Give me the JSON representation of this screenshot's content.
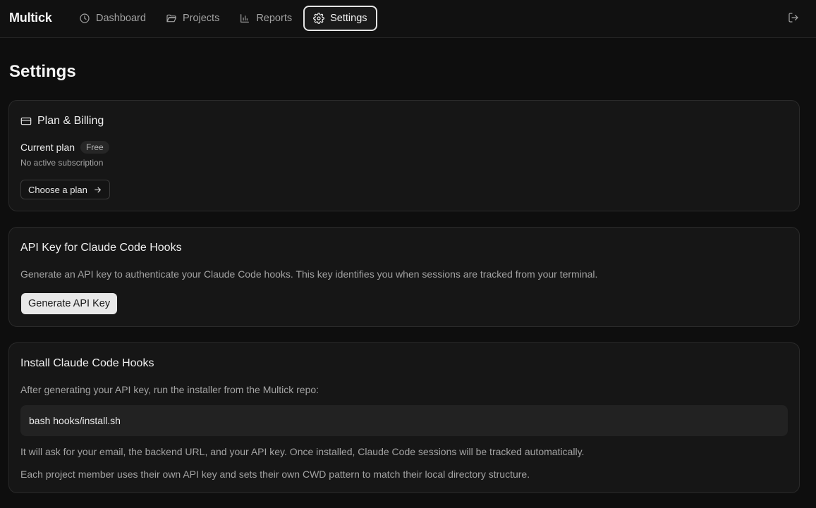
{
  "header": {
    "brand": "Multick",
    "nav": [
      {
        "label": "Dashboard",
        "icon": "clock-icon"
      },
      {
        "label": "Projects",
        "icon": "folder-icon"
      },
      {
        "label": "Reports",
        "icon": "bar-chart-icon"
      },
      {
        "label": "Settings",
        "icon": "gear-icon",
        "active": true
      }
    ],
    "logout_icon": "logout-icon"
  },
  "page": {
    "title": "Settings"
  },
  "billing": {
    "title": "Plan & Billing",
    "icon": "credit-card-icon",
    "current_plan_label": "Current plan",
    "plan_badge": "Free",
    "subscription_status": "No active subscription",
    "choose_plan_label": "Choose a plan"
  },
  "api_key": {
    "title": "API Key for Claude Code Hooks",
    "description": "Generate an API key to authenticate your Claude Code hooks. This key identifies you when sessions are tracked from your terminal.",
    "generate_label": "Generate API Key"
  },
  "install": {
    "title": "Install Claude Code Hooks",
    "intro": "After generating your API key, run the installer from the Multick repo:",
    "command": "bash hooks/install.sh",
    "note1": "It will ask for your email, the backend URL, and your API key. Once installed, Claude Code sessions will be tracked automatically.",
    "note2": "Each project member uses their own API key and sets their own CWD pattern to match their local directory structure."
  },
  "colors": {
    "background": "#0e0e0e",
    "card": "#161616",
    "border": "#2a2a2a",
    "primary_button": "#e8e8e8",
    "muted_text": "#a3a3a3"
  }
}
